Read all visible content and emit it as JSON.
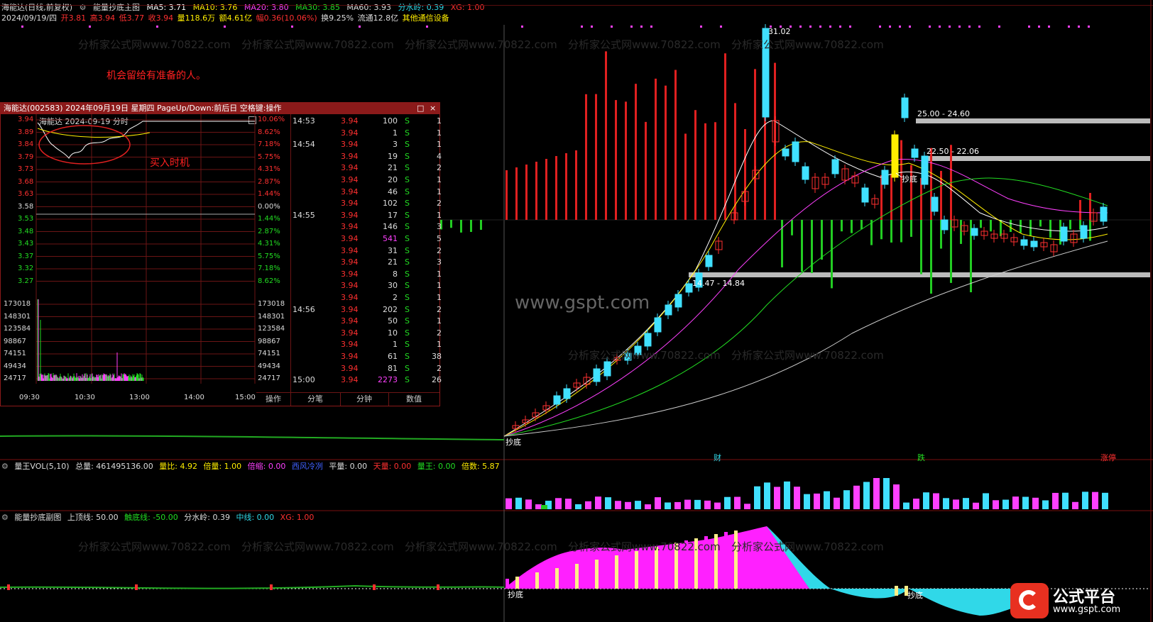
{
  "header": {
    "stock": "海能达(日线,前复权)",
    "indicator": "能量抄底主图",
    "ma5": "MA5: 3.71",
    "ma10": "MA10: 3.76",
    "ma20": "MA20: 3.80",
    "ma30": "MA30: 3.85",
    "ma60": "MA60: 3.93",
    "fsl": "分水岭: 0.39",
    "xg": "XG: 1.00",
    "date": "2024/09/19/四",
    "open": "开3.81",
    "high": "高3.94",
    "low": "低3.77",
    "close": "收3.94",
    "vol": "量118.6万",
    "amount": "额4.61亿",
    "change": "幅0.36(10.06%)",
    "turnover": "换9.25%",
    "float": "流通12.8亿",
    "industry": "其他通信设备"
  },
  "annotations": {
    "slogan": "机会留给有准备的人。",
    "buy_timing": "买入时机",
    "peak": "31.02",
    "band1": "25.00 - 24.60",
    "band2": "22.50 - 22.06",
    "band3": "14.47 - 14.84",
    "chaodi1": "抄底",
    "chaodi2": "抄底",
    "chaodi3": "抄底",
    "chaodi4": "抄底",
    "watermark_big": "www.gspt.com",
    "watermark_small": "分析家公式网www.70822.com",
    "brand_name": "公式平台",
    "brand_url": "www.gspt.com",
    "sig_cai": "财",
    "sig_die": "跌",
    "sig_zhangting": "涨停"
  },
  "popup": {
    "title": "海能达(002583) 2024年09月19日 星期四 PageUp/Down:前后日 空格键:操作",
    "chart_title": "海能达   2024-09-19 分时",
    "price_labels": [
      "3.94",
      "3.89",
      "3.84",
      "3.79",
      "3.73",
      "3.68",
      "3.63",
      "3.58",
      "3.53",
      "3.48",
      "3.43",
      "3.37",
      "3.32",
      "3.27"
    ],
    "pct_labels": [
      "10.06%",
      "8.62%",
      "7.18%",
      "5.75%",
      "4.31%",
      "2.87%",
      "1.44%",
      "0.00%",
      "1.44%",
      "2.87%",
      "4.31%",
      "5.75%",
      "7.18%",
      "8.62%"
    ],
    "vol_labels": [
      "173018",
      "148301",
      "123584",
      "98867",
      "74151",
      "49434",
      "24717"
    ],
    "time_labels": [
      "09:30",
      "10:30",
      "13:00",
      "14:00",
      "15:00"
    ],
    "ticks": [
      {
        "t": "14:53",
        "p": "3.94",
        "v": "100",
        "s": "S",
        "n": "1"
      },
      {
        "t": "",
        "p": "3.94",
        "v": "1",
        "s": "S",
        "n": "1"
      },
      {
        "t": "14:54",
        "p": "3.94",
        "v": "3",
        "s": "S",
        "n": "1"
      },
      {
        "t": "",
        "p": "3.94",
        "v": "19",
        "s": "S",
        "n": "4"
      },
      {
        "t": "",
        "p": "3.94",
        "v": "21",
        "s": "S",
        "n": "2"
      },
      {
        "t": "",
        "p": "3.94",
        "v": "20",
        "s": "S",
        "n": "1"
      },
      {
        "t": "",
        "p": "3.94",
        "v": "46",
        "s": "S",
        "n": "1"
      },
      {
        "t": "",
        "p": "3.94",
        "v": "102",
        "s": "S",
        "n": "2"
      },
      {
        "t": "14:55",
        "p": "3.94",
        "v": "17",
        "s": "S",
        "n": "1"
      },
      {
        "t": "",
        "p": "3.94",
        "v": "146",
        "s": "S",
        "n": "3"
      },
      {
        "t": "",
        "p": "3.94",
        "v": "541",
        "s": "S",
        "n": "5"
      },
      {
        "t": "",
        "p": "3.94",
        "v": "31",
        "s": "S",
        "n": "2"
      },
      {
        "t": "",
        "p": "3.94",
        "v": "21",
        "s": "S",
        "n": "3"
      },
      {
        "t": "",
        "p": "3.94",
        "v": "8",
        "s": "S",
        "n": "1"
      },
      {
        "t": "",
        "p": "3.94",
        "v": "30",
        "s": "S",
        "n": "1"
      },
      {
        "t": "",
        "p": "3.94",
        "v": "2",
        "s": "S",
        "n": "1"
      },
      {
        "t": "14:56",
        "p": "3.94",
        "v": "202",
        "s": "S",
        "n": "2"
      },
      {
        "t": "",
        "p": "3.94",
        "v": "50",
        "s": "S",
        "n": "1"
      },
      {
        "t": "",
        "p": "3.94",
        "v": "10",
        "s": "S",
        "n": "2"
      },
      {
        "t": "",
        "p": "3.94",
        "v": "1",
        "s": "S",
        "n": "1"
      },
      {
        "t": "",
        "p": "3.94",
        "v": "61",
        "s": "S",
        "n": "38"
      },
      {
        "t": "",
        "p": "3.94",
        "v": "81",
        "s": "S",
        "n": "2"
      },
      {
        "t": "15:00",
        "p": "3.94",
        "v": "2273",
        "s": "S",
        "n": "26"
      }
    ],
    "tabs": [
      "操作",
      "分笔",
      "分钟",
      "数值"
    ]
  },
  "vol_panel": {
    "name": "量王VOL(5,10)",
    "total": "总量: 461495136.00",
    "ratio": "量比: 4.92",
    "bei": "倍量: 1.00",
    "suo": "倍缩: 0.00",
    "xsjs": "西风冷冽",
    "ping": "平量: 0.00",
    "tian": "天量: 0.00",
    "wang": "量王: 0.00",
    "beishu": "倍数: 5.87"
  },
  "sub_panel": {
    "name": "能量抄底副图",
    "top": "上顶线: 50.00",
    "bottom": "触底线: -50.00",
    "fsl": "分水岭: 0.39",
    "mid": "中线: 0.00",
    "xg": "XG: 1.00"
  },
  "colors": {
    "up": "#ff3030",
    "down": "#40e0ff",
    "green": "#22dd22",
    "magenta": "#ff20ff",
    "yellow": "#ffee00",
    "cyan": "#30d8e8"
  }
}
